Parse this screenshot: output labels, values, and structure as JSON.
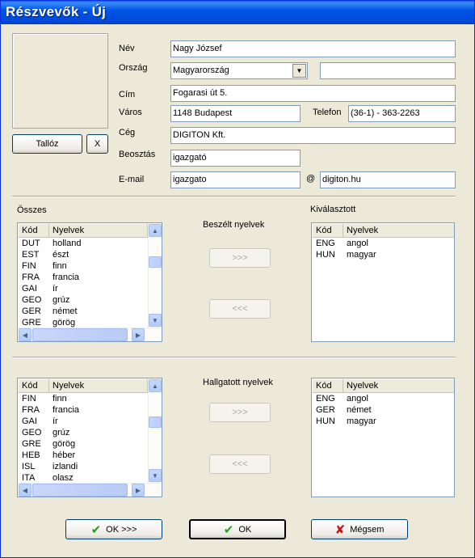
{
  "window": {
    "title": "Részvevők - Új"
  },
  "photo": {
    "browse_label": "Tallóz",
    "clear_label": "X"
  },
  "form": {
    "name_label": "Név",
    "name_value": "Nagy József",
    "country_label": "Ország",
    "country_value": "Magyarország",
    "country_extra": "",
    "address_label": "Cím",
    "address_value": "Fogarasi út 5.",
    "city_label": "Város",
    "city_value": "1148 Budapest",
    "phone_label": "Telefon",
    "phone_value": "(36-1) - 363-2263",
    "company_label": "Cég",
    "company_value": "DIGITON Kft.",
    "position_label": "Beosztás",
    "position_value": "igazgató",
    "email_label": "E-mail",
    "email_user": "igazgato",
    "email_at": "@",
    "email_domain": "digiton.hu"
  },
  "spoken": {
    "all_label": "Összes",
    "section_title": "Beszélt nyelvek",
    "selected_label": "Kiválasztott",
    "add_label": ">>>",
    "remove_label": "<<<",
    "columns": [
      "Kód",
      "Nyelvek"
    ],
    "all_rows": [
      [
        "DUT",
        "holland"
      ],
      [
        "EST",
        "észt"
      ],
      [
        "FIN",
        "finn"
      ],
      [
        "FRA",
        "francia"
      ],
      [
        "GAI",
        "ír"
      ],
      [
        "GEO",
        "grúz"
      ],
      [
        "GER",
        "német"
      ],
      [
        "GRE",
        "görög"
      ]
    ],
    "selected_rows": [
      [
        "ENG",
        "angol"
      ],
      [
        "HUN",
        "magyar"
      ]
    ]
  },
  "heard": {
    "section_title": "Hallgatott nyelvek",
    "add_label": ">>>",
    "remove_label": "<<<",
    "columns": [
      "Kód",
      "Nyelvek"
    ],
    "all_rows": [
      [
        "FIN",
        "finn"
      ],
      [
        "FRA",
        "francia"
      ],
      [
        "GAI",
        "ír"
      ],
      [
        "GEO",
        "grúz"
      ],
      [
        "GRE",
        "görög"
      ],
      [
        "HEB",
        "héber"
      ],
      [
        "ISL",
        "izlandi"
      ],
      [
        "ITA",
        "olasz"
      ]
    ],
    "selected_rows": [
      [
        "ENG",
        "angol"
      ],
      [
        "GER",
        "német"
      ],
      [
        "HUN",
        "magyar"
      ]
    ]
  },
  "footer": {
    "ok_next_label": "OK >>>",
    "ok_label": "OK",
    "cancel_label": "Mégsem"
  }
}
